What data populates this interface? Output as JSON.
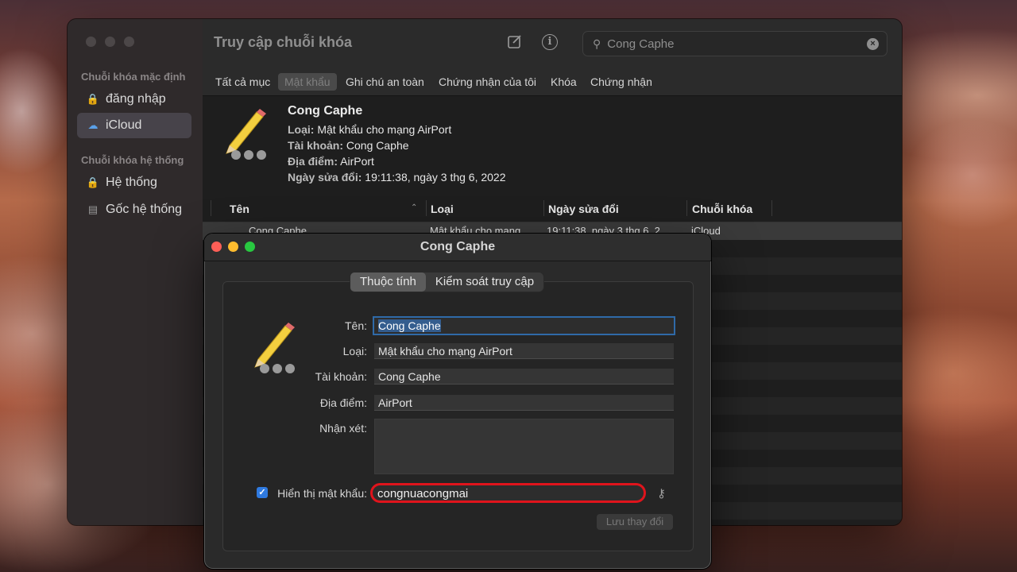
{
  "main_window": {
    "title": "Truy cập chuỗi khóa",
    "sidebar": {
      "default_section": "Chuỗi khóa mặc định",
      "default_items": [
        {
          "label": "đăng nhập",
          "icon": "lock-icon"
        },
        {
          "label": "iCloud",
          "icon": "cloud-icon"
        }
      ],
      "system_section": "Chuỗi khóa hệ thống",
      "system_items": [
        {
          "label": "Hệ thống",
          "icon": "lock-icon"
        },
        {
          "label": "Gốc hệ thống",
          "icon": "cabinet-icon"
        }
      ],
      "selected": "iCloud"
    },
    "search": {
      "value": "Cong Caphe"
    },
    "tabs": [
      "Tất cả mục",
      "Mật khẩu",
      "Ghi chú an toàn",
      "Chứng nhận của tôi",
      "Khóa",
      "Chứng nhận"
    ],
    "active_tab": "Mật khẩu",
    "detail": {
      "name": "Cong Caphe",
      "type_label": "Loại:",
      "type_value": "Mật khẩu cho mạng AirPort",
      "account_label": "Tài khoản:",
      "account_value": "Cong Caphe",
      "location_label": "Địa điểm:",
      "location_value": "AirPort",
      "modified_label": "Ngày sửa đổi:",
      "modified_value": "19:11:38, ngày 3 thg 6, 2022"
    },
    "columns": [
      "Tên",
      "Loại",
      "Ngày sửa đổi",
      "Chuỗi khóa"
    ],
    "row": {
      "name": "Cong Caphe",
      "type": "Mật khẩu cho mạng",
      "date": "19:11:38, ngày 3 thg 6, 2",
      "keychain": "iCloud"
    }
  },
  "dialog": {
    "title": "Cong Caphe",
    "tabs": [
      "Thuộc tính",
      "Kiểm soát truy cập"
    ],
    "active_tab": "Thuộc tính",
    "fields": {
      "name_label": "Tên:",
      "name_value": "Cong Caphe",
      "type_label": "Loại:",
      "type_value": "Mật khẩu cho mạng AirPort",
      "account_label": "Tài khoản:",
      "account_value": "Cong Caphe",
      "location_label": "Địa điểm:",
      "location_value": "AirPort",
      "comment_label": "Nhận xét:"
    },
    "show_password_label": "Hiển thị mật khẩu:",
    "show_password_checked": true,
    "password": "congnuacongmai",
    "save_label": "Lưu thay đổi"
  },
  "colors": {
    "highlight_ring": "#e0141c",
    "accent": "#2f7ae0",
    "close": "#ff5f57",
    "minimize": "#febc2e",
    "zoom": "#28c840"
  }
}
